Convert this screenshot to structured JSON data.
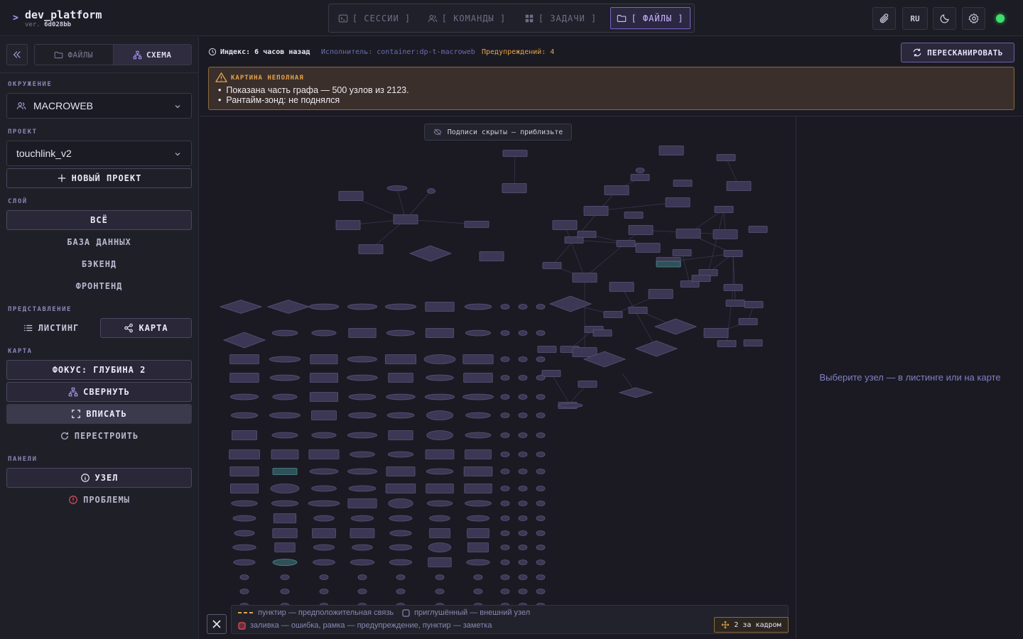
{
  "app": {
    "name": "dev_platform",
    "caret": ">",
    "version_label": "ver.",
    "version": "6d028bb"
  },
  "nav": {
    "tabs": [
      {
        "label": "[ СЕССИИ ]",
        "icon": "terminal-icon"
      },
      {
        "label": "[ КОМАНДЫ ]",
        "icon": "users-icon"
      },
      {
        "label": "[ ЗАДАЧИ ]",
        "icon": "grid-icon"
      },
      {
        "label": "[ ФАЙЛЫ ]",
        "icon": "folder-icon",
        "active": true
      }
    ]
  },
  "toolbar": {
    "language": "RU",
    "status_color": "#3ee06b"
  },
  "sidebar": {
    "tabs": [
      {
        "label": "ФАЙЛЫ"
      },
      {
        "label": "СХЕМА",
        "active": true
      }
    ],
    "environment_label": "ОКРУЖЕНИЕ",
    "environment_value": "MACROWEB",
    "project_label": "ПРОЕКТ",
    "project_value": "touchlink_v2",
    "new_project": "НОВЫЙ ПРОЕКТ",
    "layer_label": "СЛОЙ",
    "layers": [
      "ВСЁ",
      "БАЗА ДАННЫХ",
      "БЭКЕНД",
      "ФРОНТЕНД"
    ],
    "view_label": "ПРЕДСТАВЛЕНИЕ",
    "views": [
      "ЛИСТИНГ",
      "КАРТА"
    ],
    "map_label": "КАРТА",
    "map_actions": [
      "ФОКУС: ГЛУБИНА 2",
      "СВЕРНУТЬ",
      "ВПИСАТЬ",
      "ПЕРЕСТРОИТЬ"
    ],
    "panels_label": "ПАНЕЛИ",
    "panels": [
      "УЗЕЛ",
      "ПРОБЛЕМЫ"
    ]
  },
  "infobar": {
    "index": "Индекс: 6 часов назад",
    "executor": "Исполнитель: container:dp-t-macroweb",
    "warnings": "Предупреждений: 4",
    "rescan": "ПЕРЕСКАНИРОВАТЬ"
  },
  "warning": {
    "title": "КАРТИНА НЕПОЛНАЯ",
    "items": [
      "Показана часть графа — 500 узлов из 2123.",
      "Рантайм-зонд: не поднялся"
    ]
  },
  "canvas": {
    "labels_hint": "Подписи скрыты — приблизьте",
    "legend": {
      "dashed": "пунктир — предположительная связь",
      "muted": "приглушённый — внешний узел",
      "fill": "заливка — ошибка, рамка — предупреждение, пунктир — заметка"
    },
    "offscreen": "2 за кадром"
  },
  "detail": {
    "hint": "Выберите узел — в листинге или на карте"
  },
  "colors": {
    "accent": "#b59cff",
    "warning": "#e6a34c",
    "node_fill": "#3c3754",
    "node_stroke": "#5b5578",
    "highlight": "#2f5158"
  }
}
